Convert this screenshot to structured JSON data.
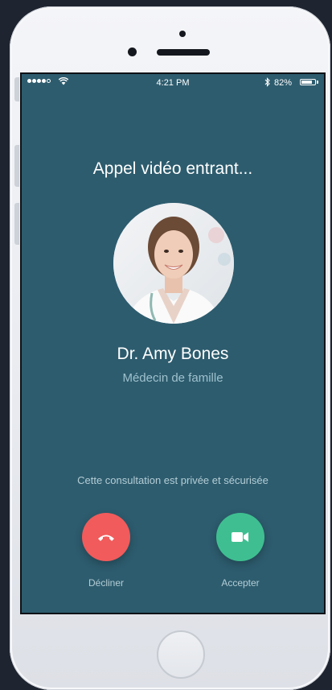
{
  "status_bar": {
    "time": "4:21 PM",
    "battery_percent": "82%",
    "battery_level": 0.82,
    "signal_bars": 4,
    "signal_total": 5
  },
  "call": {
    "title": "Appel vidéo entrant...",
    "caller_name": "Dr. Amy Bones",
    "caller_role": "Médecin de famille",
    "privacy_note": "Cette consultation est privée et sécurisée"
  },
  "actions": {
    "decline_label": "Décliner",
    "accept_label": "Accepter"
  },
  "icons": {
    "decline": "phone-hangup-icon",
    "accept": "video-camera-icon"
  },
  "colors": {
    "screen_background": "#2d5c6e",
    "decline": "#f15b5b",
    "accept": "#3fbf91",
    "secondary_text": "#9fc1cd"
  }
}
